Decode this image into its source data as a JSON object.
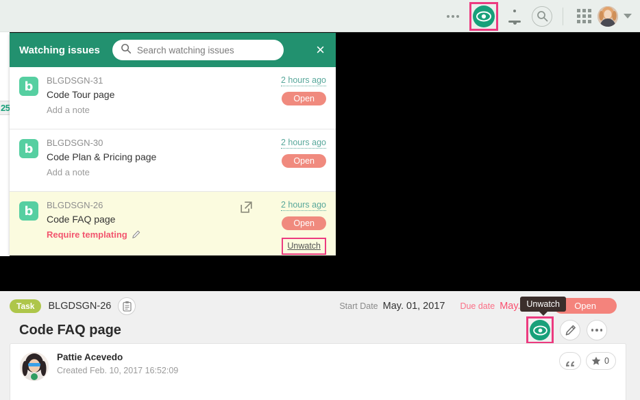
{
  "topbar": {
    "more_icon": "more-horizontal-icon",
    "watch_icon": "eye-watch-icon",
    "notifications_icon": "bell-icon",
    "search_icon": "search-icon",
    "apps_icon": "grid-apps-icon",
    "avatar_icon": "user-avatar",
    "account_chevron": "chevron-down-icon"
  },
  "background": {
    "partial_chip": "25"
  },
  "panel": {
    "title": "Watching issues",
    "search": {
      "placeholder": "Search watching issues",
      "value": "",
      "icon": "search-icon"
    },
    "close_label": "×",
    "issues": [
      {
        "project_initial": "b",
        "key": "BLGDSGN-31",
        "summary": "Code Tour page",
        "note": "Add a note",
        "note_is_alert": false,
        "time": "2 hours ago",
        "status": "Open",
        "highlighted": false,
        "show_external_link": false,
        "unwatch_label": ""
      },
      {
        "project_initial": "b",
        "key": "BLGDSGN-30",
        "summary": "Code Plan & Pricing page",
        "note": "Add a note",
        "note_is_alert": false,
        "time": "2 hours ago",
        "status": "Open",
        "highlighted": false,
        "show_external_link": false,
        "unwatch_label": ""
      },
      {
        "project_initial": "b",
        "key": "BLGDSGN-26",
        "summary": "Code FAQ page",
        "note": "Require templating",
        "note_is_alert": true,
        "time": "2 hours ago",
        "status": "Open",
        "highlighted": true,
        "show_external_link": true,
        "unwatch_label": "Unwatch"
      }
    ]
  },
  "detail": {
    "type_badge": "Task",
    "issue_key": "BLGDSGN-26",
    "clipboard_icon": "clipboard-icon",
    "start_date_label": "Start Date",
    "start_date_value": "May. 01, 2017",
    "due_date_label": "Due date",
    "due_date_value": "May. 05, 2017",
    "status": "Open",
    "title": "Code FAQ page",
    "tooltip": "Unwatch",
    "watch_icon": "eye-watch-icon",
    "edit_icon": "pencil-icon",
    "more_icon": "more-horizontal-icon",
    "comment": {
      "author": "Pattie Acevedo",
      "created_label": "Created",
      "created_value": "Feb. 10, 2017 16:52:09",
      "quote_icon": "quote-icon",
      "star_icon": "star-icon",
      "star_count": "0"
    }
  },
  "colors": {
    "brand_green": "#22916f",
    "watch_green": "#18a07a",
    "highlight_pink": "#ec3a7f",
    "status_open": "#f08a7e",
    "task_badge": "#aec64a",
    "due_date": "#fa4f6f",
    "row_highlight": "#fbfbdf",
    "topbar_bg": "#eaefec"
  }
}
